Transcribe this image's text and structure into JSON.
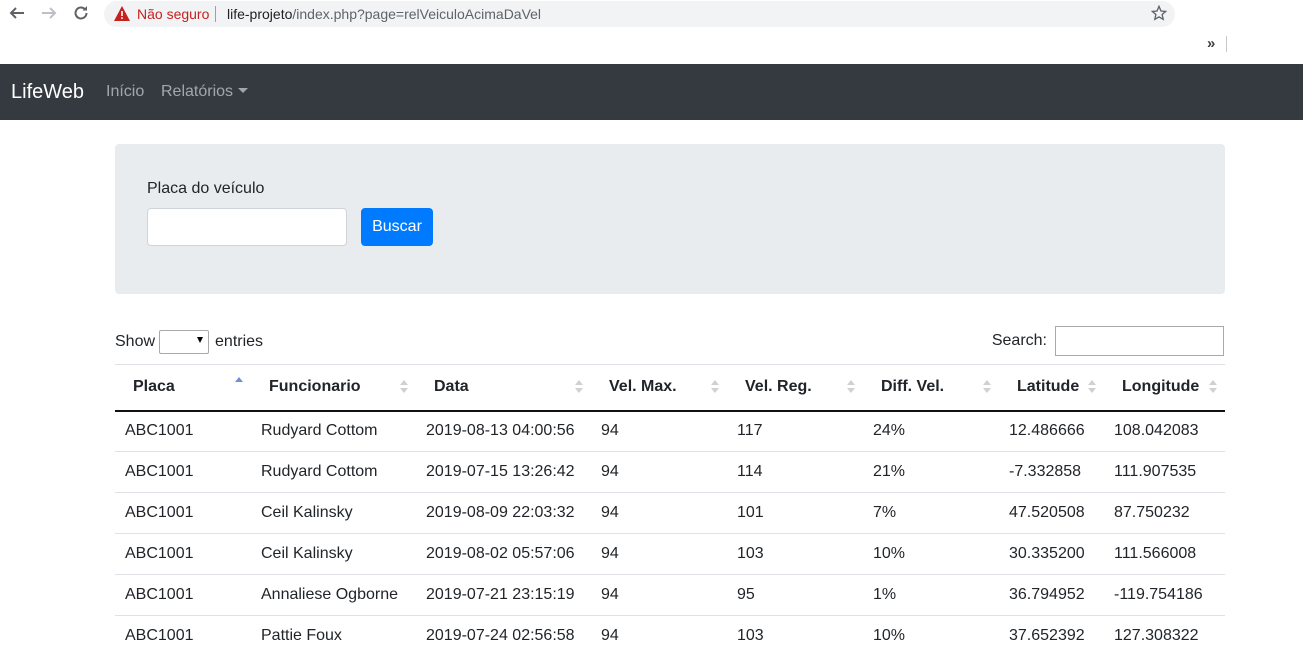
{
  "browser": {
    "insecure_label": "Não seguro",
    "url_host": "life-projeto",
    "url_path": "/index.php?page=relVeiculoAcimaDaVel",
    "extensions_chevron": "»"
  },
  "navbar": {
    "brand": "LifeWeb",
    "links": [
      {
        "label": "Início"
      },
      {
        "label": "Relatórios"
      }
    ]
  },
  "search_form": {
    "label": "Placa do veículo",
    "input_value": "",
    "button_label": "Buscar"
  },
  "table_controls": {
    "show_label": "Show",
    "entries_label": "entries",
    "search_label": "Search:",
    "length_value": ""
  },
  "table": {
    "columns": [
      "Placa",
      "Funcionario",
      "Data",
      "Vel. Max.",
      "Vel. Reg.",
      "Diff. Vel.",
      "Latitude",
      "Longitude"
    ],
    "sorted_column": "Placa",
    "rows": [
      [
        "ABC1001",
        "Rudyard Cottom",
        "2019-08-13 04:00:56",
        "94",
        "117",
        "24%",
        "12.486666",
        "108.042083"
      ],
      [
        "ABC1001",
        "Rudyard Cottom",
        "2019-07-15 13:26:42",
        "94",
        "114",
        "21%",
        "-7.332858",
        "111.907535"
      ],
      [
        "ABC1001",
        "Ceil Kalinsky",
        "2019-08-09 22:03:32",
        "94",
        "101",
        "7%",
        "47.520508",
        "87.750232"
      ],
      [
        "ABC1001",
        "Ceil Kalinsky",
        "2019-08-02 05:57:06",
        "94",
        "103",
        "10%",
        "30.335200",
        "111.566008"
      ],
      [
        "ABC1001",
        "Annaliese Ogborne",
        "2019-07-21 23:15:19",
        "94",
        "95",
        "1%",
        "36.794952",
        "-119.754186"
      ],
      [
        "ABC1001",
        "Pattie Foux",
        "2019-07-24 02:56:58",
        "94",
        "103",
        "10%",
        "37.652392",
        "127.308322"
      ]
    ]
  },
  "colors": {
    "navbar_bg": "#343a40",
    "primary": "#007bff",
    "jumbotron_bg": "#e9ecef"
  }
}
